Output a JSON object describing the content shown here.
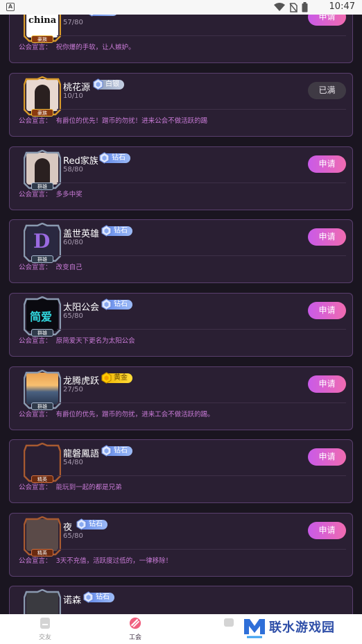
{
  "status_bar": {
    "time": "10:47"
  },
  "apply_label": "申请",
  "full_label": "已满",
  "declare_prefix": "公会宣言：",
  "colors": {
    "background": "#1a1520",
    "card": "#2a1f33",
    "card_border": "#5a3f6e",
    "apply_gradient": [
      "#c95ae8",
      "#f06bb0"
    ],
    "declare_text": "#c97bd7"
  },
  "guilds": [
    {
      "name": "china",
      "level": "钻石",
      "level_type": "diamond",
      "members": "57/80",
      "status": "apply",
      "declaration": "祝你爆的手软，让人嫉妒。",
      "rank_tag": "豪族"
    },
    {
      "name": "桃花源",
      "level": "白银",
      "level_type": "silver",
      "members": "10/10",
      "status": "full",
      "declaration": "有爵位的优先！蹭币的勿扰！进来公会不做活跃的踢",
      "rank_tag": "豪族"
    },
    {
      "name": "Red家族",
      "level": "钻石",
      "level_type": "diamond",
      "members": "58/80",
      "status": "apply",
      "declaration": "多多中奖",
      "rank_tag": "群雄"
    },
    {
      "name": "盖世英雄",
      "level": "钻石",
      "level_type": "diamond",
      "members": "60/80",
      "status": "apply",
      "declaration": "改变自己",
      "rank_tag": "群雄"
    },
    {
      "name": "太阳公会",
      "level": "钻石",
      "level_type": "diamond",
      "members": "65/80",
      "status": "apply",
      "declaration": "原简爱天下更名为太阳公会",
      "rank_tag": "群雄"
    },
    {
      "name": "龙腾虎跃",
      "level": "黄金",
      "level_type": "gold",
      "members": "27/50",
      "status": "apply",
      "declaration": "有爵位的优先，蹭币的勿扰，进来工会不做活跃的踢。",
      "rank_tag": "群雄"
    },
    {
      "name": "龍磐鳳語",
      "level": "钻石",
      "level_type": "diamond",
      "members": "54/80",
      "status": "apply",
      "declaration": "能玩到一起的都是兄弟",
      "rank_tag": "精英"
    },
    {
      "name": "夜",
      "level": "钻石",
      "level_type": "diamond",
      "members": "65/80",
      "status": "apply",
      "declaration": "3天不充值，活跃度过低的，一律移除！",
      "rank_tag": "精英"
    },
    {
      "name": "诺森",
      "level": "钻石",
      "level_type": "diamond",
      "members": "",
      "status": "apply",
      "declaration": "",
      "rank_tag": ""
    }
  ],
  "avatar_texts": {
    "china_logo": "china",
    "jianai": "简爱"
  },
  "tabs": [
    {
      "label": "交友",
      "icon": "home-icon",
      "active": false
    },
    {
      "label": "工会",
      "icon": "guild-icon",
      "active": true
    },
    {
      "label": "",
      "icon": "message-icon",
      "active": false
    }
  ],
  "watermark": {
    "text": "联水游戏园",
    "icon": "lianshui-logo-icon"
  }
}
